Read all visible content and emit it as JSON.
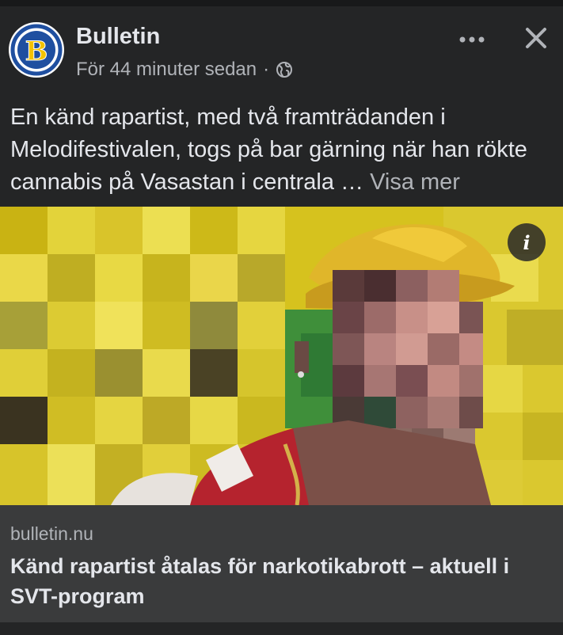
{
  "post": {
    "page_name": "Bulletin",
    "timestamp": "För 44 minuter sedan",
    "separator": "·",
    "audience_icon": "globe-icon",
    "caption": "En känd rapartist, med två framträdanden i Melodifestivalen, togs på bar gärning när han rökte cannabis på Vasastan i centrala …",
    "see_more": "Visa mer"
  },
  "avatar": {
    "letter": "B",
    "colors": {
      "ring": "#1f4fa0",
      "letter": "#f2c200"
    }
  },
  "icons": {
    "more": "more-options-icon",
    "close": "close-icon",
    "info": "info-icon"
  },
  "info_label": "i",
  "link": {
    "domain": "bulletin.nu",
    "headline": "Känd rapartist åtalas för narkotikabrott – aktuell i SVT-program"
  },
  "colors": {
    "background": "#242526",
    "link_box": "#3a3b3c",
    "text_primary": "#e4e6eb",
    "text_secondary": "#b0b3b8"
  }
}
